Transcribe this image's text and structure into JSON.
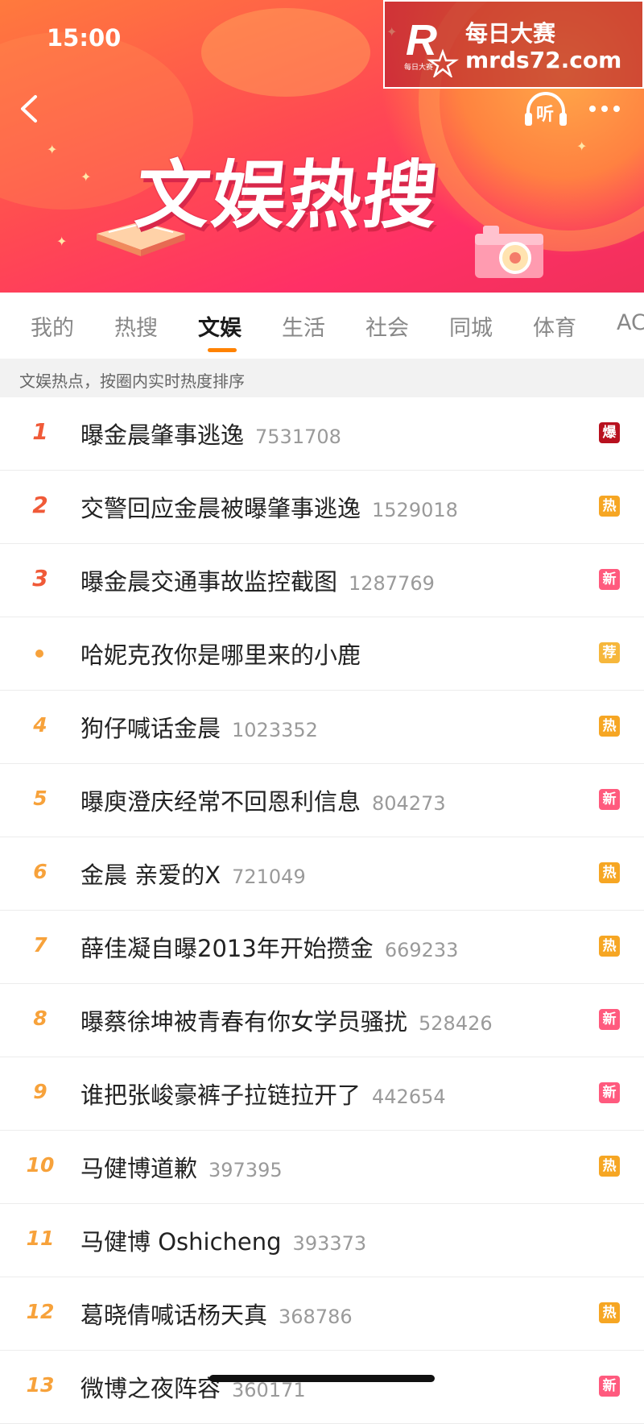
{
  "status_bar": {
    "time": "15:00"
  },
  "watermark": {
    "logo_text": "R",
    "logo_sub": "每日大赛",
    "title": "每日大赛",
    "url": "mrds72.com"
  },
  "header": {
    "title": "文娱热搜",
    "back_icon": "chevron-left-icon",
    "listen_label": "听",
    "more_icon": "more-dots-icon"
  },
  "tabs": [
    {
      "label": "我的"
    },
    {
      "label": "热搜"
    },
    {
      "label": "文娱",
      "active": true
    },
    {
      "label": "生活"
    },
    {
      "label": "社会"
    },
    {
      "label": "同城"
    },
    {
      "label": "体育"
    },
    {
      "label": "AC"
    }
  ],
  "hint": "文娱热点，按圈内实时热度排序",
  "colors": {
    "accent": "#ff8200",
    "rank_top": "#f05a38",
    "rank": "#f7a23b",
    "badge_bao": "#b8111f",
    "badge_re": "#f6a623",
    "badge_xin": "#ff5a7e",
    "badge_jian": "#f6b73c"
  },
  "list": [
    {
      "rank": "1",
      "topic": "曝金晨肇事逃逸",
      "count": "7531708",
      "badge": "爆",
      "badge_color": "#b8111f"
    },
    {
      "rank": "2",
      "topic": "交警回应金晨被曝肇事逃逸",
      "count": "1529018",
      "badge": "热",
      "badge_color": "#f6a623"
    },
    {
      "rank": "3",
      "topic": "曝金晨交通事故监控截图",
      "count": "1287769",
      "badge": "新",
      "badge_color": "#ff5a7e"
    },
    {
      "rank": "",
      "topic": "哈妮克孜你是哪里来的小鹿",
      "count": "",
      "badge": "荐",
      "badge_color": "#f6b73c"
    },
    {
      "rank": "4",
      "topic": "狗仔喊话金晨",
      "count": "1023352",
      "badge": "热",
      "badge_color": "#f6a623"
    },
    {
      "rank": "5",
      "topic": "曝庾澄庆经常不回恩利信息",
      "count": "804273",
      "badge": "新",
      "badge_color": "#ff5a7e"
    },
    {
      "rank": "6",
      "topic": "金晨 亲爱的X",
      "count": "721049",
      "badge": "热",
      "badge_color": "#f6a623"
    },
    {
      "rank": "7",
      "topic": "薛佳凝自曝2013年开始攒金",
      "count": "669233",
      "badge": "热",
      "badge_color": "#f6a623"
    },
    {
      "rank": "8",
      "topic": "曝蔡徐坤被青春有你女学员骚扰",
      "count": "528426",
      "badge": "新",
      "badge_color": "#ff5a7e"
    },
    {
      "rank": "9",
      "topic": "谁把张峻豪裤子拉链拉开了",
      "count": "442654",
      "badge": "新",
      "badge_color": "#ff5a7e"
    },
    {
      "rank": "10",
      "topic": "马健博道歉",
      "count": "397395",
      "badge": "热",
      "badge_color": "#f6a623"
    },
    {
      "rank": "11",
      "topic": "马健博 Oshicheng",
      "count": "393373",
      "badge": "",
      "badge_color": ""
    },
    {
      "rank": "12",
      "topic": "葛晓倩喊话杨天真",
      "count": "368786",
      "badge": "热",
      "badge_color": "#f6a623"
    },
    {
      "rank": "13",
      "topic": "微博之夜阵容",
      "count": "360171",
      "badge": "新",
      "badge_color": "#ff5a7e"
    }
  ]
}
